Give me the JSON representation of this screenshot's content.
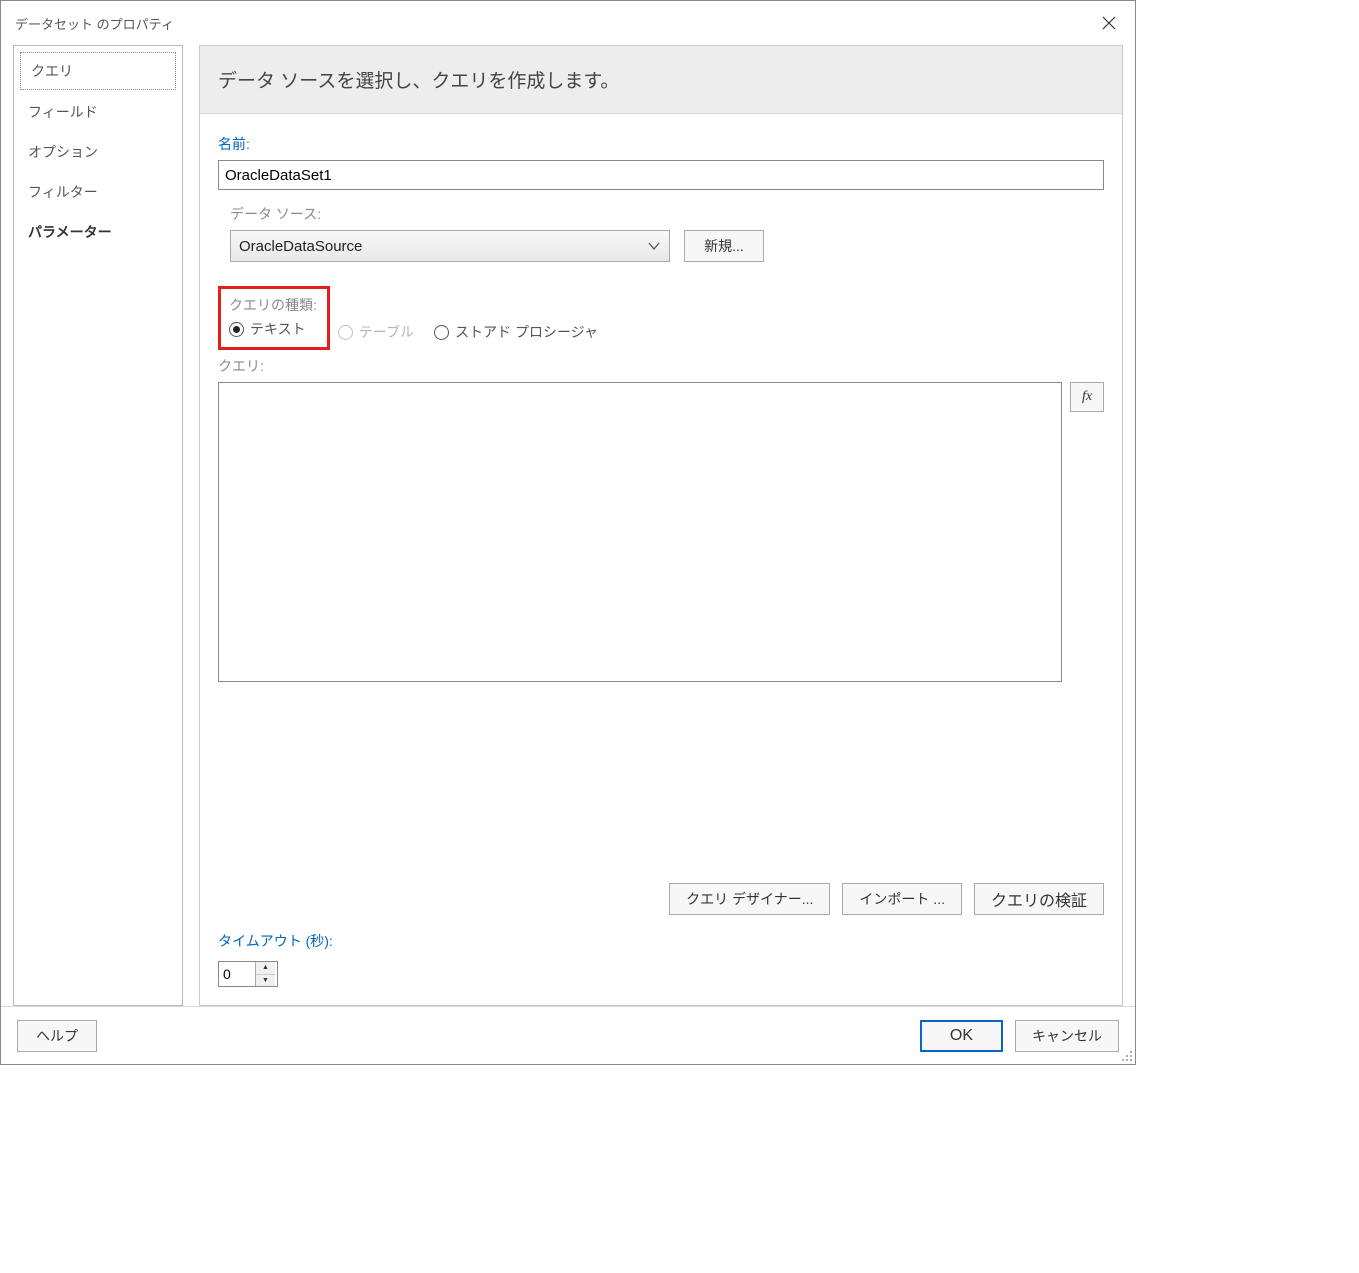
{
  "window": {
    "title": "データセット のプロパティ"
  },
  "sidebar": {
    "items": [
      {
        "label": "クエリ",
        "active": true
      },
      {
        "label": "フィールド"
      },
      {
        "label": "オプション"
      },
      {
        "label": "フィルター"
      },
      {
        "label": "パラメーター",
        "bold": true
      }
    ]
  },
  "main": {
    "heading": "データ ソースを選択し、クエリを作成します。",
    "name_label": "名前:",
    "name_value": "OracleDataSet1",
    "datasource_label": "データ ソース:",
    "datasource_value": "OracleDataSource",
    "new_button": "新規...",
    "query_type_label": "クエリの種類:",
    "query_type_options": {
      "text": "テキスト",
      "table": "テーブル",
      "sproc": "ストアド プロシージャ"
    },
    "query_label": "クエリ:",
    "query_value": "",
    "fx_label": "fx",
    "buttons": {
      "designer": "クエリ デザイナー...",
      "import": "インポート ...",
      "validate": "クエリの検証"
    },
    "timeout_label": "タイムアウト (秒):",
    "timeout_value": "0"
  },
  "footer": {
    "help": "ヘルプ",
    "ok": "OK",
    "cancel": "キャンセル"
  }
}
